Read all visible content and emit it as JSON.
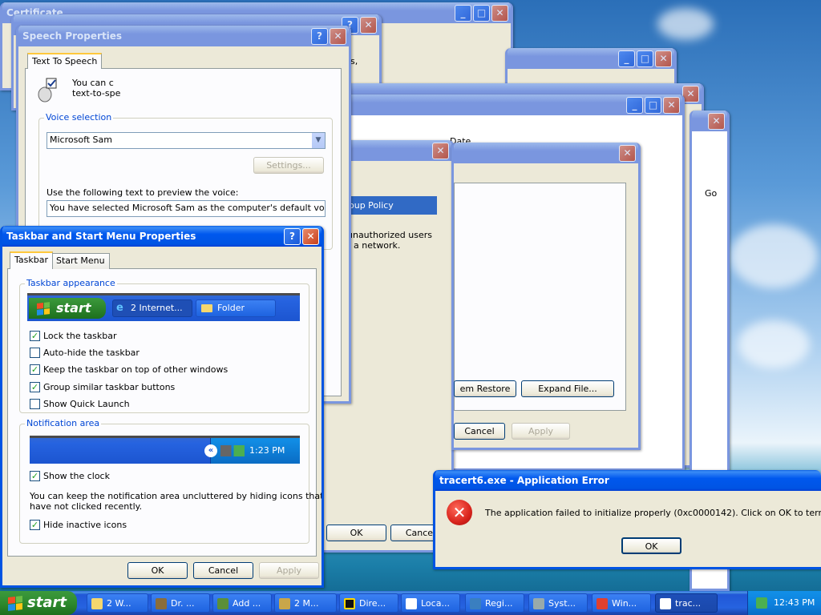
{
  "desktop": {
    "bg_windows": {
      "w1_title": "Certificate",
      "w2_text1": "s,",
      "w3_col": "Date",
      "w4_go": "Go",
      "w5_row": "oup Policy",
      "w5_text1": "unauthorized users",
      "w5_text2": "r a network.",
      "w6_btn1": "em Restore",
      "w6_btn2": "Expand File...",
      "w6_cancel": "Cancel",
      "w6_apply": "Apply",
      "w7_ok": "OK",
      "w7_cancel": "Cancel"
    }
  },
  "speech": {
    "title": "Speech Properties",
    "tab": "Text To Speech",
    "intro1": "You can c",
    "intro2": "text-to-spe",
    "voice_group": "Voice selection",
    "voice_value": "Microsoft Sam",
    "settings": "Settings...",
    "preview_label": "Use the following text to preview the voice:",
    "preview_text": "You have selected Microsoft Sam as the computer's default voice."
  },
  "taskbar_props": {
    "title": "Taskbar and Start Menu Properties",
    "tabs": [
      "Taskbar",
      "Start Menu"
    ],
    "appearance_group": "Taskbar appearance",
    "preview_start": "start",
    "preview_task1": "2 Internet...",
    "preview_task2": "Folder",
    "options": [
      {
        "label": "Lock the taskbar",
        "checked": true
      },
      {
        "label": "Auto-hide the taskbar",
        "checked": false
      },
      {
        "label": "Keep the taskbar on top of other windows",
        "checked": true
      },
      {
        "label": "Group similar taskbar buttons",
        "checked": true
      },
      {
        "label": "Show Quick Launch",
        "checked": false
      }
    ],
    "notify_group": "Notification area",
    "preview_clock": "1:23 PM",
    "show_clock": "Show the clock",
    "notify_text1": "You can keep the notification area uncluttered by hiding icons that you",
    "notify_text2": "have not clicked recently.",
    "hide_inactive": "Hide inactive icons",
    "ok": "OK",
    "cancel": "Cancel",
    "apply": "Apply"
  },
  "error": {
    "title": "tracert6.exe - Application Error",
    "message": "The application failed to initialize properly (0xc0000142). Click on OK to terminate the ap",
    "ok": "OK"
  },
  "taskbar": {
    "start": "start",
    "tasks": [
      "2 W...",
      "Dr. ...",
      "Add ...",
      "2 M...",
      "Dire...",
      "Loca...",
      "Regi...",
      "Syst...",
      "Win...",
      "trac..."
    ],
    "clock": "12:43 PM"
  },
  "colors": {
    "accent": "#0054e3",
    "start_green": "#2e8a2e",
    "error_red": "#d8241c"
  }
}
